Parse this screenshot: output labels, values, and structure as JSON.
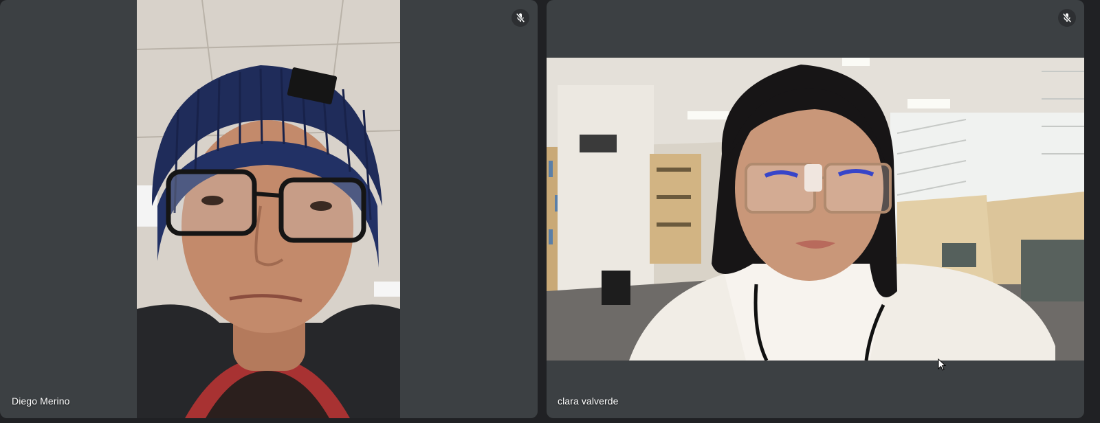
{
  "participants": [
    {
      "name": "Diego Merino",
      "mic_icon": "mic-off-icon",
      "video": "participant-camera-feed-portrait"
    },
    {
      "name": "clara valverde",
      "mic_icon": "mic-off-icon",
      "video": "participant-camera-feed-landscape"
    }
  ],
  "colors": {
    "background": "#202124",
    "tile": "#3c4043",
    "text": "#ffffff"
  }
}
